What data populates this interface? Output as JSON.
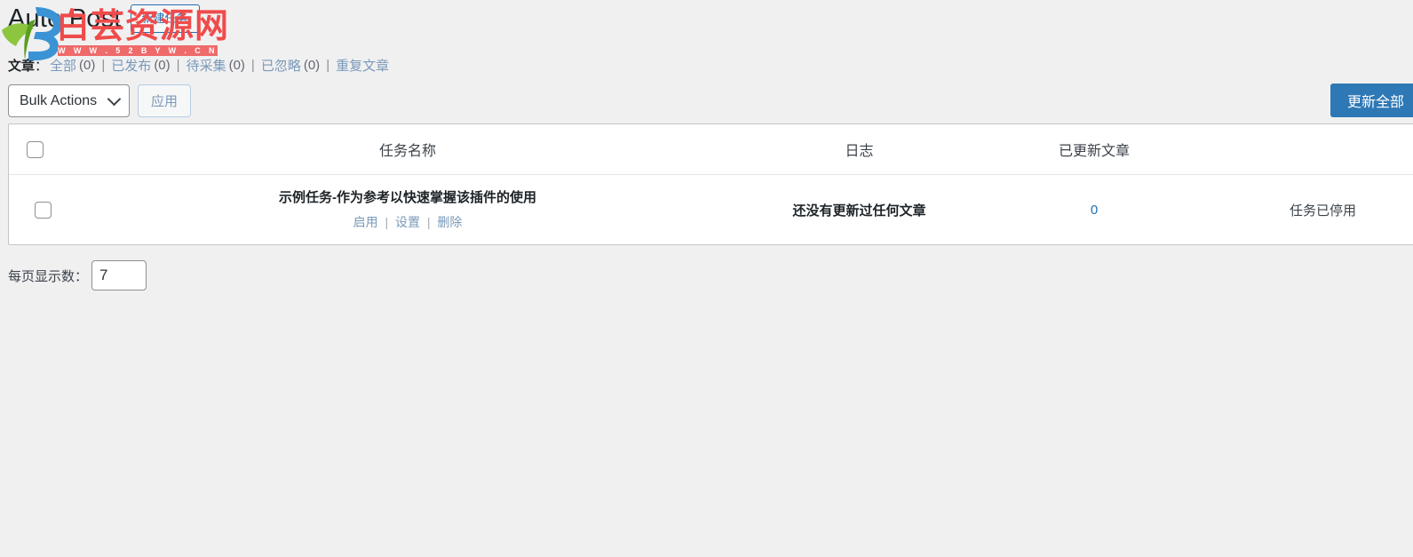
{
  "header": {
    "title": "Auto Post",
    "add_new_label": "新建任务"
  },
  "filters": {
    "label": "文章",
    "colon": "：",
    "separator": "|",
    "items": [
      {
        "label": "全部",
        "count": "(0)"
      },
      {
        "label": "已发布",
        "count": "(0)"
      },
      {
        "label": "待采集",
        "count": "(0)"
      },
      {
        "label": "已忽略",
        "count": "(0)"
      },
      {
        "label": "重复文章",
        "count": ""
      }
    ]
  },
  "toolbar": {
    "bulk_actions_value": "Bulk Actions",
    "bulk_actions_options": [
      "Bulk Actions"
    ],
    "apply_label": "应用",
    "update_all_label": "更新全部",
    "chevron_icon": "chevron-down-icon"
  },
  "table": {
    "columns": [
      "",
      "任务名称",
      "日志",
      "已更新文章",
      ""
    ],
    "rows": [
      {
        "name": "示例任务-作为参考以快速掌握该插件的使用",
        "actions": [
          "启用",
          "设置",
          "删除"
        ],
        "action_separator": "|",
        "log": "还没有更新过任何文章",
        "updated_count": "0",
        "status": "任务已停用"
      }
    ]
  },
  "footer": {
    "per_page_label": "每页显示数：",
    "per_page_value": "7"
  },
  "watermark": {
    "text": "白芸资源网",
    "url": "W W W . 5 2 B Y W . C N",
    "red": "#ef4b4b"
  }
}
